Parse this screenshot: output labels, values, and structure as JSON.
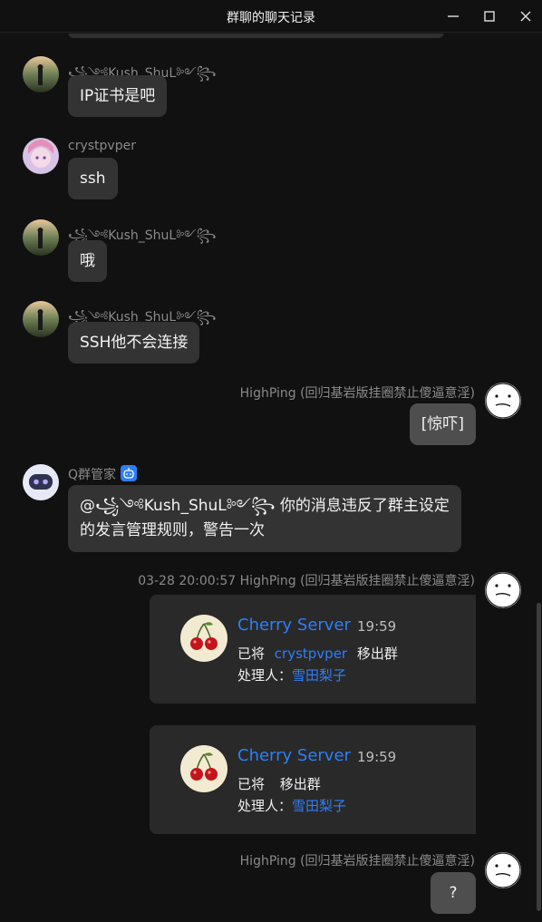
{
  "window": {
    "title": "群聊的聊天记录"
  },
  "messages": [
    {
      "sender": "꧁༺Kush_ShuL༻꧂",
      "text": "IP证书是吧"
    },
    {
      "sender": "crystpvper",
      "text": "ssh"
    },
    {
      "sender": "꧁༺Kush_ShuL༻꧂",
      "text": "哦"
    },
    {
      "sender": "꧁༺Kush_ShuL༻꧂",
      "text": "SSH他不会连接"
    },
    {
      "sender": "HighPing (回归基岩版挂圈禁止傻逼意淫)",
      "text": "[惊吓]"
    },
    {
      "sender": "Q群管家",
      "text_line1": "@꧁༺Kush_ShuL༻꧂ 你的消息违反了群主设定",
      "text_line2": "的发言管理规则，警告一次"
    },
    {
      "sender": "HighPing (回归基岩版挂圈禁止傻逼意淫)",
      "timestamp": "03-28 20:00:57"
    },
    {
      "sender": "HighPing (回归基岩版挂圈禁止傻逼意淫)",
      "text": "?"
    }
  ],
  "cards": [
    {
      "server": "Cherry Server",
      "time": "19:59",
      "prefix": "已将",
      "user": "crystpvper",
      "action": "移出群",
      "handler_label": "处理人：",
      "handler": "雪田梨子"
    },
    {
      "server": "Cherry Server",
      "time": "19:59",
      "prefix": "已将",
      "user": "",
      "action": "移出群",
      "handler_label": "处理人：",
      "handler": "雪田梨子"
    }
  ],
  "colors": {
    "background": "#111111",
    "bubble": "#333333",
    "self_bubble": "#4e4e4e",
    "link": "#2d7ff9",
    "name": "#8a8a8a"
  },
  "icons": {
    "minimize": "minimize-icon",
    "maximize": "maximize-icon",
    "close": "close-icon",
    "bot_badge": "robot-badge-icon"
  }
}
